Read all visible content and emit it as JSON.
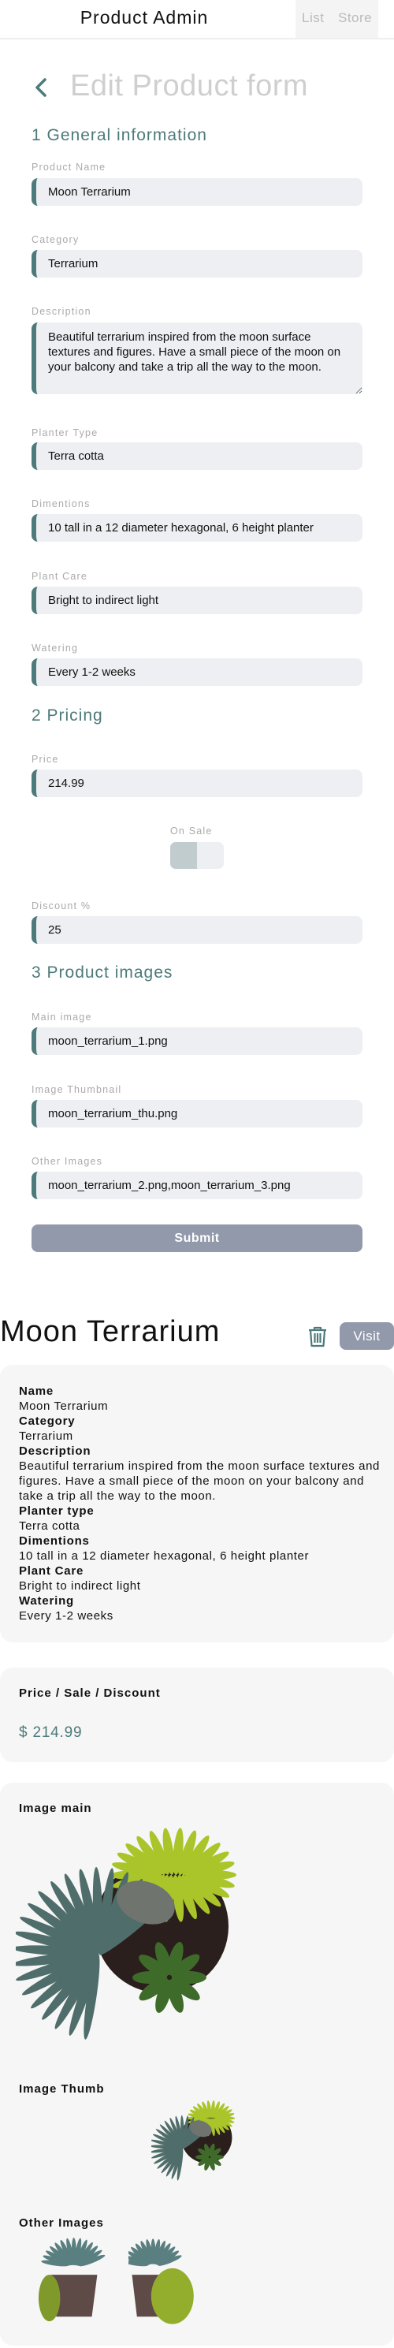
{
  "header": {
    "title": "Product Admin",
    "nav": [
      {
        "label": "List"
      },
      {
        "label": "Store"
      }
    ]
  },
  "form": {
    "title": "Edit Product form",
    "back_icon": "chevron-left-icon",
    "sections": [
      "1 General information",
      "2 Pricing",
      "3 Product images"
    ],
    "fields": {
      "product_name": {
        "label": "Product Name",
        "value": "Moon Terrarium"
      },
      "category": {
        "label": "Category",
        "value": "Terrarium"
      },
      "description": {
        "label": "Description",
        "value": "Beautiful terrarium inspired from the moon surface textures and figures. Have a small piece of the moon on your balcony and take a trip all the way to the moon."
      },
      "planter_type": {
        "label": "Planter Type",
        "value": "Terra cotta"
      },
      "dimentions": {
        "label": "Dimentions",
        "value": "10 tall in a 12 diameter hexagonal, 6 height planter"
      },
      "plant_care": {
        "label": "Plant Care",
        "value": "Bright to indirect light"
      },
      "watering": {
        "label": "Watering",
        "value": "Every 1-2 weeks"
      },
      "price": {
        "label": "Price",
        "value": "214.99"
      },
      "on_sale": {
        "label": "On Sale",
        "value": false
      },
      "discount": {
        "label": "Discount %",
        "value": "25"
      },
      "main_image": {
        "label": "Main image",
        "value": "moon_terrarium_1.png"
      },
      "image_thumbnail": {
        "label": "Image Thumbnail",
        "value": "moon_terrarium_thu.png"
      },
      "other_images": {
        "label": "Other Images",
        "value": "moon_terrarium_2.png,moon_terrarium_3.png"
      }
    },
    "submit_label": "Submit"
  },
  "detail": {
    "title": "Moon Terrarium",
    "delete_icon": "trash-icon",
    "visit_label": "Visit",
    "info": [
      {
        "key": "Name",
        "value": "Moon Terrarium"
      },
      {
        "key": "Category",
        "value": "Terrarium"
      },
      {
        "key": "Description",
        "value": "Beautiful terrarium inspired from the moon surface textures and figures. Have a small piece of the moon on your balcony and take a trip all the way to the moon."
      },
      {
        "key": "Planter type",
        "value": "Terra cotta"
      },
      {
        "key": "Dimentions",
        "value": "10 tall in a 12 diameter hexagonal, 6 height planter"
      },
      {
        "key": "Plant Care",
        "value": "Bright to indirect light"
      },
      {
        "key": "Watering",
        "value": "Every 1-2 weeks"
      }
    ],
    "pricing_heading": "Price / Sale / Discount",
    "price": "$ 214.99",
    "images": {
      "main_label": "Image main",
      "thumb_label": "Image Thumb",
      "other_label": "Other Images"
    }
  },
  "colors": {
    "accent": "#4d7a7a",
    "button": "#9199ab",
    "field_bg": "#eeeff3",
    "card_bg": "#f6f6f6"
  }
}
